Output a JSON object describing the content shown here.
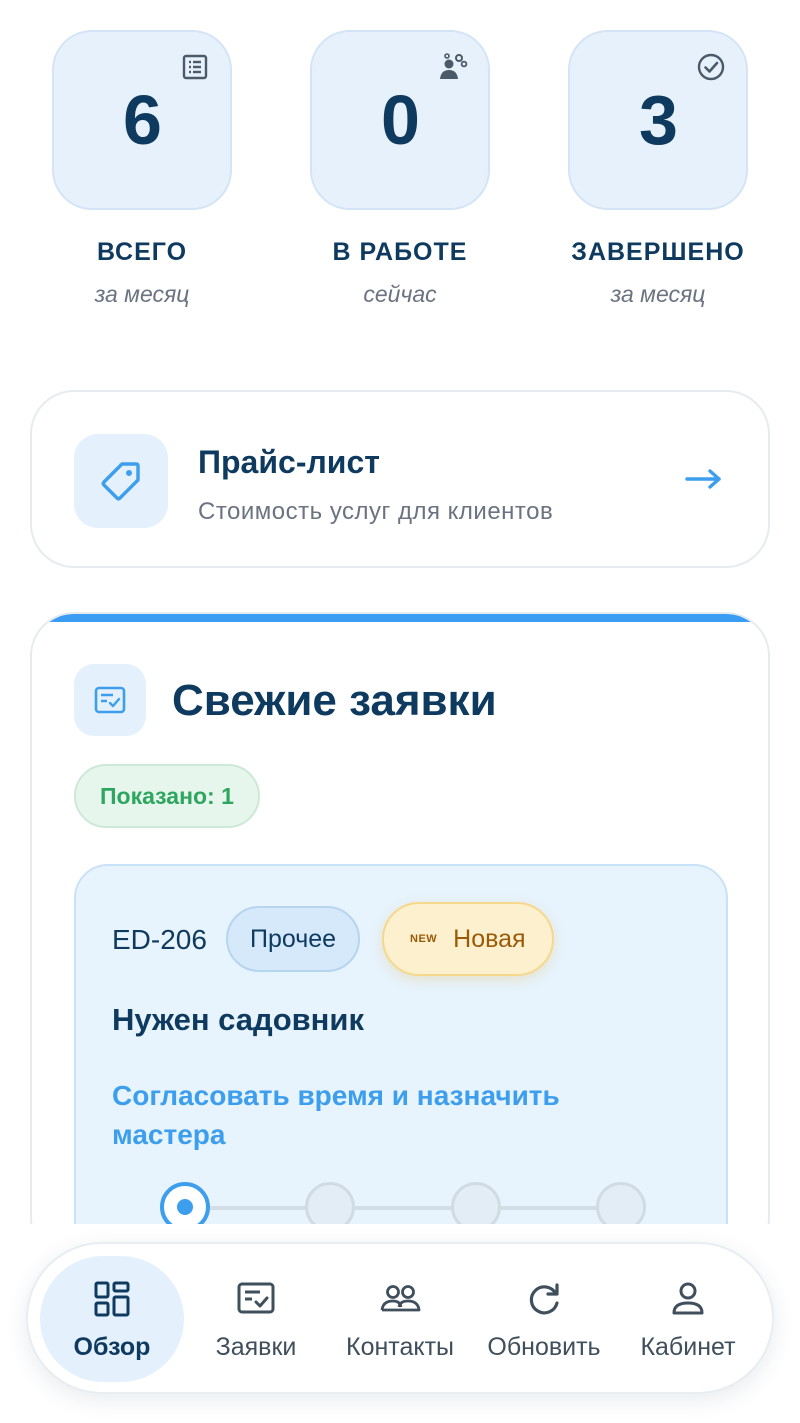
{
  "stats": [
    {
      "value": "6",
      "label": "ВСЕГО",
      "sub": "за месяц",
      "icon": "list-icon"
    },
    {
      "value": "0",
      "label": "В РАБОТЕ",
      "sub": "сейчас",
      "icon": "worker-gears-icon"
    },
    {
      "value": "3",
      "label": "ЗАВЕРШЕНО",
      "sub": "за месяц",
      "icon": "check-circle-icon"
    }
  ],
  "price": {
    "title": "Прайс-лист",
    "subtitle": "Стоимость услуг для клиентов",
    "icon": "tag-icon",
    "arrow_icon": "arrow-right-icon"
  },
  "requests": {
    "title": "Свежие заявки",
    "icon": "checklist-icon",
    "shown_label": "Показано: 1",
    "orders": [
      {
        "id": "ED-206",
        "category": "Прочее",
        "status_mark": "NEW",
        "status": "Новая",
        "title": "Нужен садовник",
        "action": "Согласовать время и назначить мастера",
        "current_step": 1,
        "total_steps": 4
      }
    ]
  },
  "nav": [
    {
      "label": "Обзор",
      "icon": "dashboard-icon",
      "active": true
    },
    {
      "label": "Заявки",
      "icon": "orders-icon",
      "active": false
    },
    {
      "label": "Контакты",
      "icon": "contacts-icon",
      "active": false
    },
    {
      "label": "Обновить",
      "icon": "refresh-icon",
      "active": false
    },
    {
      "label": "Кабинет",
      "icon": "user-icon",
      "active": false
    }
  ],
  "colors": {
    "primary_dark": "#0e3a5f",
    "accent": "#3c9eed",
    "success": "#2fa660",
    "warning": "#9a5a06"
  }
}
